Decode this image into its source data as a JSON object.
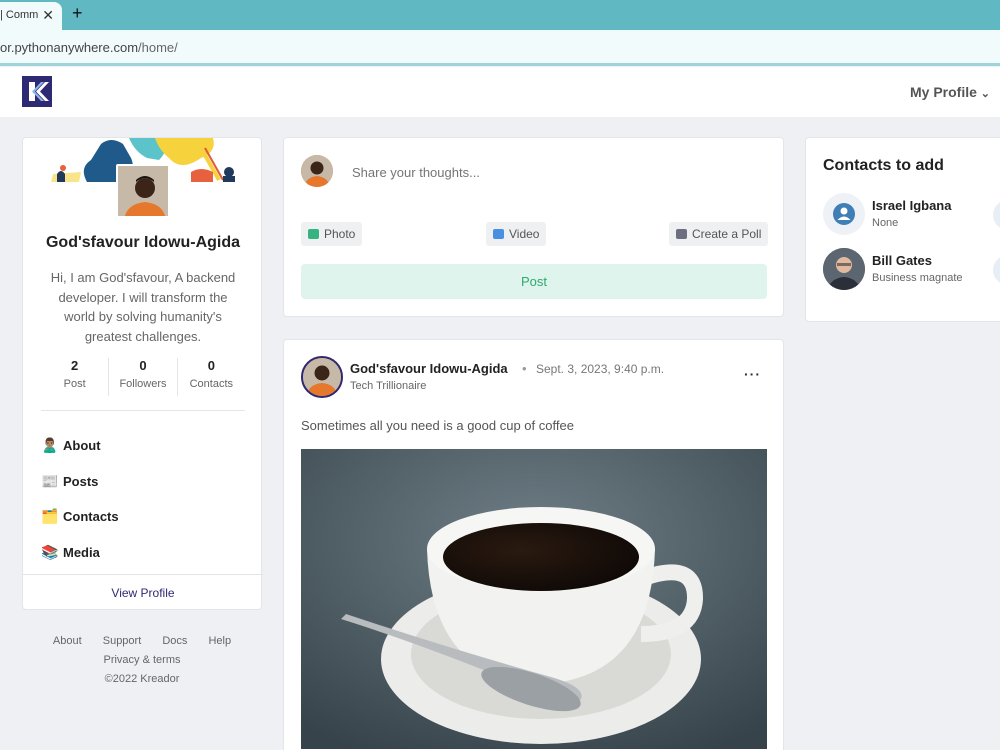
{
  "browser": {
    "tab_title": "| Comm",
    "tab_close": "✕",
    "new_tab": "+",
    "url_host": "or.pythonanywhere.com",
    "url_path": "/home/"
  },
  "navbar": {
    "my_profile": "My Profile",
    "chevron": "⌄"
  },
  "profile": {
    "name": "God'sfavour Idowu-Agida",
    "bio": "Hi, I am God'sfavour, A backend developer. I will transform the world by solving humanity's greatest challenges.",
    "stats": [
      {
        "value": "2",
        "label": "Post"
      },
      {
        "value": "0",
        "label": "Followers"
      },
      {
        "value": "0",
        "label": "Contacts"
      }
    ],
    "menu": [
      {
        "icon": "🙎🏽‍♂️",
        "label": "About"
      },
      {
        "icon": "📰",
        "label": "Posts"
      },
      {
        "icon": "🗂️",
        "label": "Contacts"
      },
      {
        "icon": "📚",
        "label": "Media"
      }
    ],
    "view_profile": "View Profile"
  },
  "footer": {
    "links": [
      "About",
      "Support",
      "Docs",
      "Help"
    ],
    "privacy": "Privacy & terms",
    "copyright": "©2022 Kreador"
  },
  "composer": {
    "placeholder": "Share your thoughts...",
    "photo": "Photo",
    "video": "Video",
    "poll": "Create a Poll",
    "post": "Post"
  },
  "feed_post": {
    "author": "God'sfavour Idowu-Agida",
    "date": "Sept. 3, 2023, 9:40 p.m.",
    "role": "Tech Trillionaire",
    "text": "Sometimes all you need is a good cup of coffee",
    "more": "···"
  },
  "contacts": {
    "title": "Contacts to add",
    "items": [
      {
        "name": "Israel Igbana",
        "role": "None"
      },
      {
        "name": "Bill Gates",
        "role": "Business magnate"
      }
    ]
  },
  "colors": {
    "brand": "#2d2a73",
    "accent_green": "#2eaa70",
    "tab_bar": "#5fb8c2"
  }
}
